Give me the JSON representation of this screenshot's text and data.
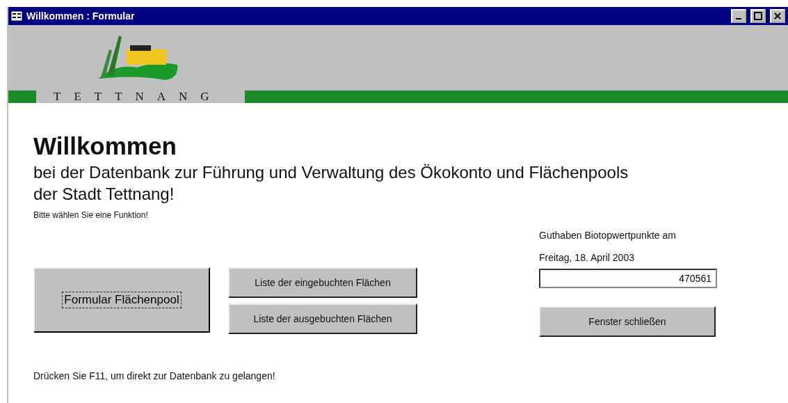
{
  "window": {
    "title": "Willkommen : Formular"
  },
  "header": {
    "logo_text": "TETTNANG"
  },
  "heading": "Willkommen",
  "subtitle": "bei der Datenbank zur Führung und Verwaltung des Ökokonto und Flächenpools der Stadt Tettnang!",
  "prompt": "Bitte wählen Sie eine Funktion!",
  "main_button": {
    "label": "Formular Flächenpool",
    "focused": true
  },
  "list_buttons": [
    "Liste der eingebuchten Flächen",
    "Liste der ausgebuchten Flächen"
  ],
  "balance": {
    "label": "Guthaben Biotopwertpunkte am",
    "date": "Freitag, 18. April 2003",
    "value": "470561"
  },
  "close_button": "Fenster schließen",
  "footer": "Drücken Sie F11, um direkt zur Datenbank zu gelangen!"
}
